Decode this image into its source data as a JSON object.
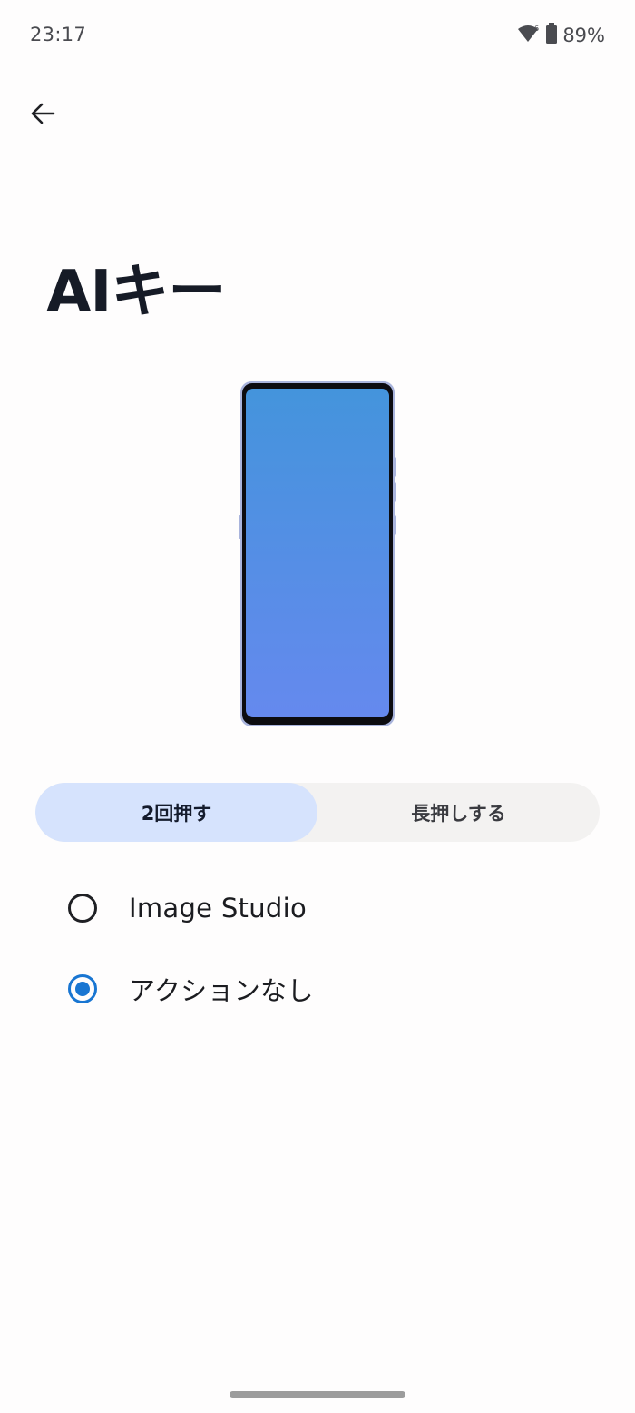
{
  "status_bar": {
    "time": "23:17",
    "battery": "89%",
    "wifi_icon": "wifi-icon",
    "battery_icon": "battery-icon"
  },
  "header": {
    "back_icon": "arrow-back-icon",
    "title": "AIキー"
  },
  "tabs": [
    {
      "label": "2回押す",
      "selected": true
    },
    {
      "label": "長押しする",
      "selected": false
    }
  ],
  "options": [
    {
      "label": "Image Studio",
      "selected": false
    },
    {
      "label": "アクションなし",
      "selected": true
    }
  ],
  "colors": {
    "accent": "#1976d2",
    "tab_selected_bg": "#d6e3fd",
    "tab_track_bg": "#f3f2f1",
    "phone_screen_top": "#4494dc",
    "phone_screen_bottom": "#6589ee",
    "phone_frame": "#a9b4dc"
  }
}
